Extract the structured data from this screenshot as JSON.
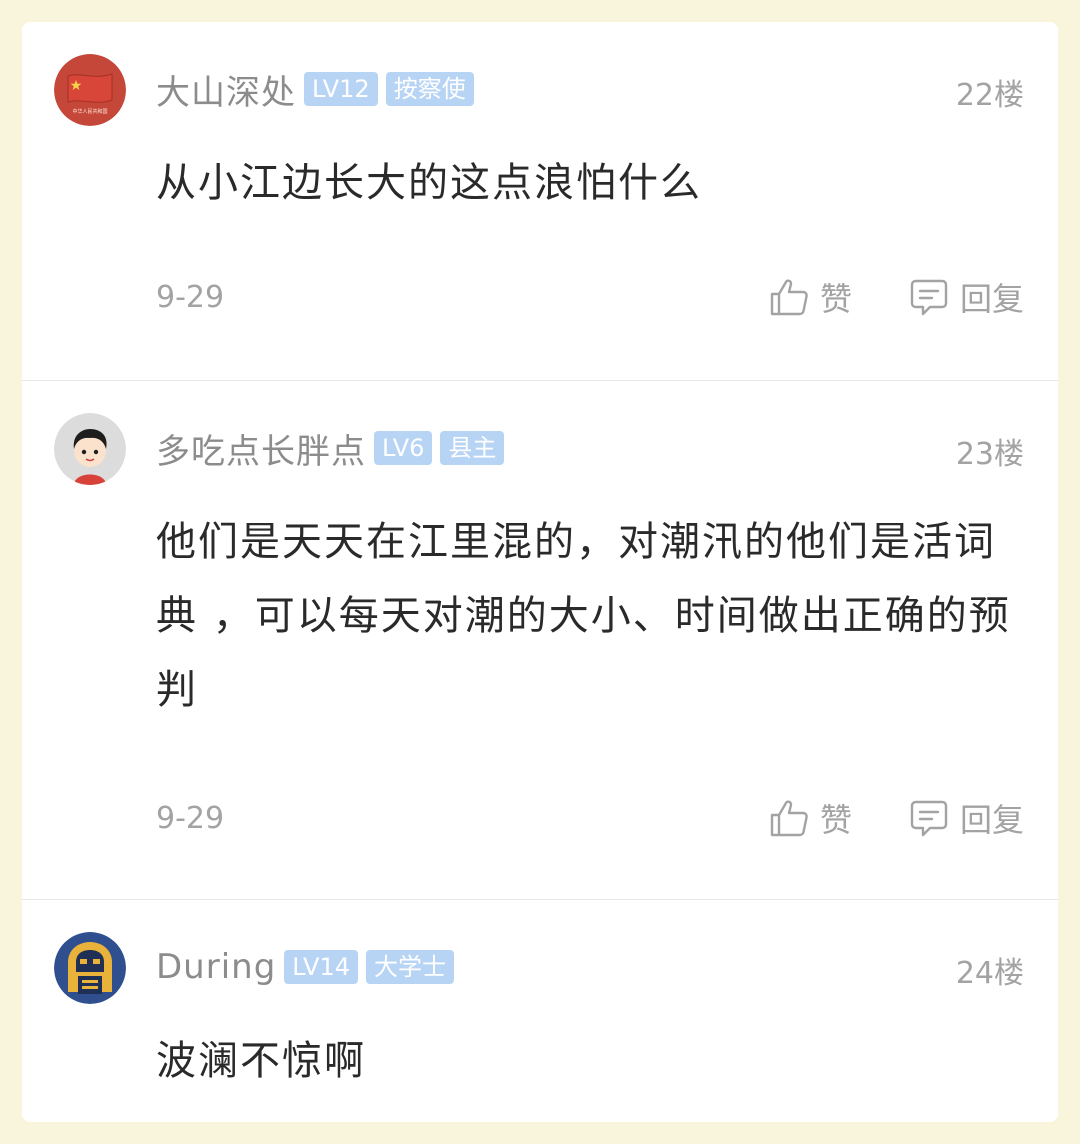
{
  "posts": [
    {
      "username": "大山深处",
      "level": "LV12",
      "title": "按察使",
      "floor": "22楼",
      "content": "从小江边长大的这点浪怕什么",
      "date": "9-29",
      "like_label": "赞",
      "reply_label": "回复"
    },
    {
      "username": "多吃点长胖点",
      "level": "LV6",
      "title": "县主",
      "floor": "23楼",
      "content": "他们是天天在江里混的，对潮汛的他们是活词典 ，可以每天对潮的大小、时间做出正确的预判",
      "date": "9-29",
      "like_label": "赞",
      "reply_label": "回复"
    },
    {
      "username": "During",
      "level": "LV14",
      "title": "大学士",
      "floor": "24楼",
      "content": "波澜不惊啊"
    }
  ],
  "avatar_1_text": "中华人民共和国",
  "colors": {
    "background": "#f8f5dc",
    "badge": "#b8d4f5",
    "meta_text": "#a3a3a3",
    "content_text": "#2a2a2a"
  },
  "icons": {
    "like": "thumbs-up-icon",
    "reply": "comment-icon"
  }
}
